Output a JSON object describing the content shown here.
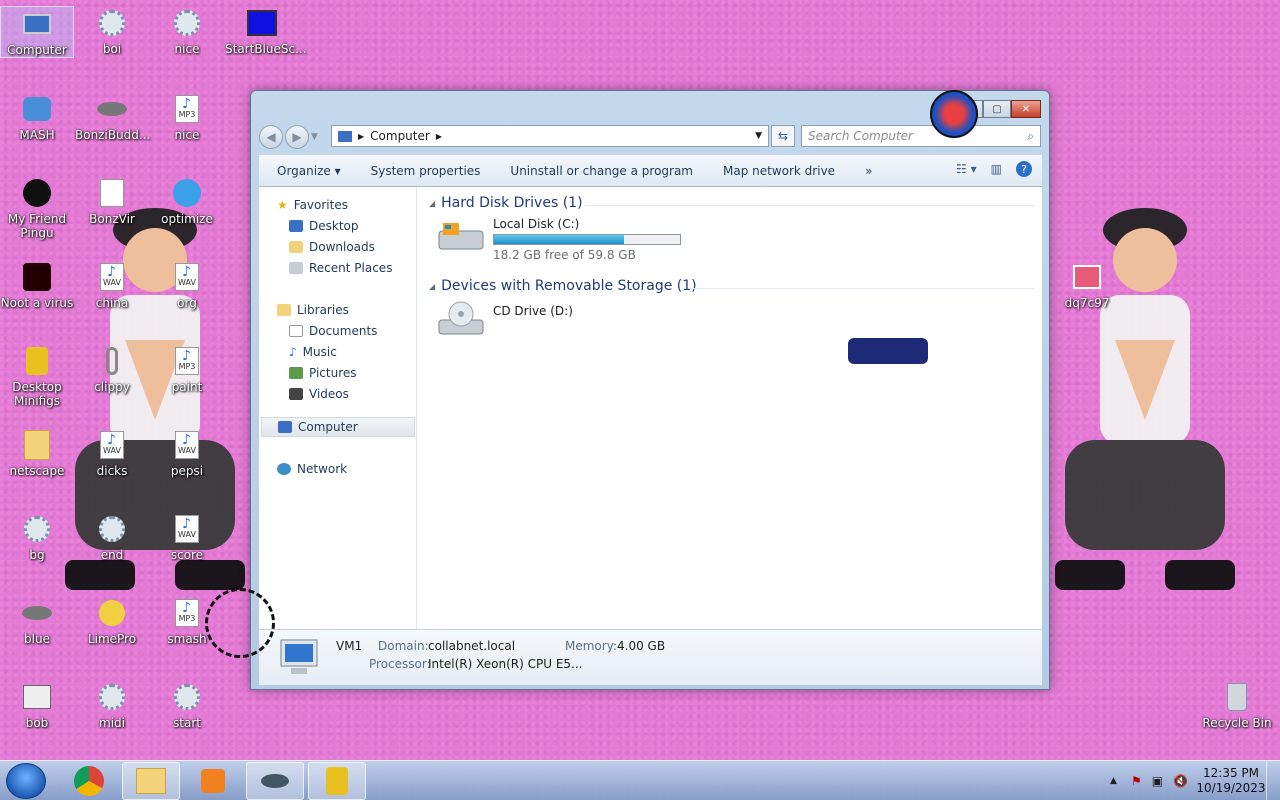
{
  "desktop_icons": [
    {
      "label": "Computer",
      "x": "c1",
      "y": "r1"
    },
    {
      "label": "boi"
    },
    {
      "label": "nice"
    },
    {
      "label": "StartBlueSc..."
    },
    {
      "label": "MASH"
    },
    {
      "label": "BonziBudd..."
    },
    {
      "label": "nice"
    },
    {
      "label": "My Friend Pingu"
    },
    {
      "label": "BonzVir"
    },
    {
      "label": "optimize"
    },
    {
      "label": "Noot a virus"
    },
    {
      "label": "china"
    },
    {
      "label": "org"
    },
    {
      "label": "Desktop Minifigs"
    },
    {
      "label": "clippy"
    },
    {
      "label": "paint"
    },
    {
      "label": "netscape"
    },
    {
      "label": "dicks"
    },
    {
      "label": "pepsi"
    },
    {
      "label": "bg"
    },
    {
      "label": "end"
    },
    {
      "label": "score"
    },
    {
      "label": "blue"
    },
    {
      "label": "LimePro"
    },
    {
      "label": "smash"
    },
    {
      "label": "bob"
    },
    {
      "label": "midi"
    },
    {
      "label": "start"
    },
    {
      "label": "dq7c97"
    },
    {
      "label": "Recycle Bin"
    }
  ],
  "file_badges": {
    "mp3": "MP3",
    "wav": "WAV"
  },
  "explorer": {
    "address": "Computer",
    "search_placeholder": "Search Computer",
    "toolbar": {
      "organize": "Organize",
      "system_properties": "System properties",
      "uninstall": "Uninstall or change a program",
      "map_drive": "Map network drive",
      "more": "»"
    },
    "nav": {
      "favorites": "Favorites",
      "desktop": "Desktop",
      "downloads": "Downloads",
      "recent": "Recent Places",
      "libraries": "Libraries",
      "documents": "Documents",
      "music": "Music",
      "pictures": "Pictures",
      "videos": "Videos",
      "computer": "Computer",
      "network": "Network"
    },
    "groups": {
      "hdd": "Hard Disk Drives (1)",
      "removable": "Devices with Removable Storage (1)"
    },
    "drives": {
      "c_name": "Local Disk (C:)",
      "c_free": "18.2 GB free of 59.8 GB",
      "c_used_fraction": 0.7,
      "d_name": "CD Drive (D:)"
    },
    "details": {
      "name": "VM1",
      "domain_label": "Domain:",
      "domain_value": "collabnet.local",
      "memory_label": "Memory:",
      "memory_value": "4.00 GB",
      "processor_label": "Processor:",
      "processor_value": "Intel(R) Xeon(R) CPU E5..."
    }
  },
  "clock": {
    "time": "12:35 PM",
    "date": "10/19/2023"
  }
}
